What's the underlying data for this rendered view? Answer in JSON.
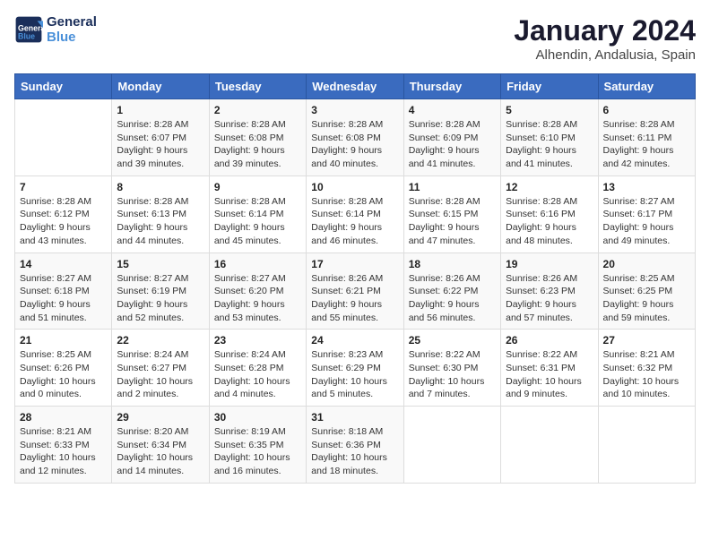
{
  "logo": {
    "line1": "General",
    "line2": "Blue"
  },
  "title": "January 2024",
  "subtitle": "Alhendin, Andalusia, Spain",
  "days_of_week": [
    "Sunday",
    "Monday",
    "Tuesday",
    "Wednesday",
    "Thursday",
    "Friday",
    "Saturday"
  ],
  "weeks": [
    [
      {
        "day": "",
        "info": ""
      },
      {
        "day": "1",
        "info": "Sunrise: 8:28 AM\nSunset: 6:07 PM\nDaylight: 9 hours\nand 39 minutes."
      },
      {
        "day": "2",
        "info": "Sunrise: 8:28 AM\nSunset: 6:08 PM\nDaylight: 9 hours\nand 39 minutes."
      },
      {
        "day": "3",
        "info": "Sunrise: 8:28 AM\nSunset: 6:08 PM\nDaylight: 9 hours\nand 40 minutes."
      },
      {
        "day": "4",
        "info": "Sunrise: 8:28 AM\nSunset: 6:09 PM\nDaylight: 9 hours\nand 41 minutes."
      },
      {
        "day": "5",
        "info": "Sunrise: 8:28 AM\nSunset: 6:10 PM\nDaylight: 9 hours\nand 41 minutes."
      },
      {
        "day": "6",
        "info": "Sunrise: 8:28 AM\nSunset: 6:11 PM\nDaylight: 9 hours\nand 42 minutes."
      }
    ],
    [
      {
        "day": "7",
        "info": "Sunrise: 8:28 AM\nSunset: 6:12 PM\nDaylight: 9 hours\nand 43 minutes."
      },
      {
        "day": "8",
        "info": "Sunrise: 8:28 AM\nSunset: 6:13 PM\nDaylight: 9 hours\nand 44 minutes."
      },
      {
        "day": "9",
        "info": "Sunrise: 8:28 AM\nSunset: 6:14 PM\nDaylight: 9 hours\nand 45 minutes."
      },
      {
        "day": "10",
        "info": "Sunrise: 8:28 AM\nSunset: 6:14 PM\nDaylight: 9 hours\nand 46 minutes."
      },
      {
        "day": "11",
        "info": "Sunrise: 8:28 AM\nSunset: 6:15 PM\nDaylight: 9 hours\nand 47 minutes."
      },
      {
        "day": "12",
        "info": "Sunrise: 8:28 AM\nSunset: 6:16 PM\nDaylight: 9 hours\nand 48 minutes."
      },
      {
        "day": "13",
        "info": "Sunrise: 8:27 AM\nSunset: 6:17 PM\nDaylight: 9 hours\nand 49 minutes."
      }
    ],
    [
      {
        "day": "14",
        "info": "Sunrise: 8:27 AM\nSunset: 6:18 PM\nDaylight: 9 hours\nand 51 minutes."
      },
      {
        "day": "15",
        "info": "Sunrise: 8:27 AM\nSunset: 6:19 PM\nDaylight: 9 hours\nand 52 minutes."
      },
      {
        "day": "16",
        "info": "Sunrise: 8:27 AM\nSunset: 6:20 PM\nDaylight: 9 hours\nand 53 minutes."
      },
      {
        "day": "17",
        "info": "Sunrise: 8:26 AM\nSunset: 6:21 PM\nDaylight: 9 hours\nand 55 minutes."
      },
      {
        "day": "18",
        "info": "Sunrise: 8:26 AM\nSunset: 6:22 PM\nDaylight: 9 hours\nand 56 minutes."
      },
      {
        "day": "19",
        "info": "Sunrise: 8:26 AM\nSunset: 6:23 PM\nDaylight: 9 hours\nand 57 minutes."
      },
      {
        "day": "20",
        "info": "Sunrise: 8:25 AM\nSunset: 6:25 PM\nDaylight: 9 hours\nand 59 minutes."
      }
    ],
    [
      {
        "day": "21",
        "info": "Sunrise: 8:25 AM\nSunset: 6:26 PM\nDaylight: 10 hours\nand 0 minutes."
      },
      {
        "day": "22",
        "info": "Sunrise: 8:24 AM\nSunset: 6:27 PM\nDaylight: 10 hours\nand 2 minutes."
      },
      {
        "day": "23",
        "info": "Sunrise: 8:24 AM\nSunset: 6:28 PM\nDaylight: 10 hours\nand 4 minutes."
      },
      {
        "day": "24",
        "info": "Sunrise: 8:23 AM\nSunset: 6:29 PM\nDaylight: 10 hours\nand 5 minutes."
      },
      {
        "day": "25",
        "info": "Sunrise: 8:22 AM\nSunset: 6:30 PM\nDaylight: 10 hours\nand 7 minutes."
      },
      {
        "day": "26",
        "info": "Sunrise: 8:22 AM\nSunset: 6:31 PM\nDaylight: 10 hours\nand 9 minutes."
      },
      {
        "day": "27",
        "info": "Sunrise: 8:21 AM\nSunset: 6:32 PM\nDaylight: 10 hours\nand 10 minutes."
      }
    ],
    [
      {
        "day": "28",
        "info": "Sunrise: 8:21 AM\nSunset: 6:33 PM\nDaylight: 10 hours\nand 12 minutes."
      },
      {
        "day": "29",
        "info": "Sunrise: 8:20 AM\nSunset: 6:34 PM\nDaylight: 10 hours\nand 14 minutes."
      },
      {
        "day": "30",
        "info": "Sunrise: 8:19 AM\nSunset: 6:35 PM\nDaylight: 10 hours\nand 16 minutes."
      },
      {
        "day": "31",
        "info": "Sunrise: 8:18 AM\nSunset: 6:36 PM\nDaylight: 10 hours\nand 18 minutes."
      },
      {
        "day": "",
        "info": ""
      },
      {
        "day": "",
        "info": ""
      },
      {
        "day": "",
        "info": ""
      }
    ]
  ]
}
